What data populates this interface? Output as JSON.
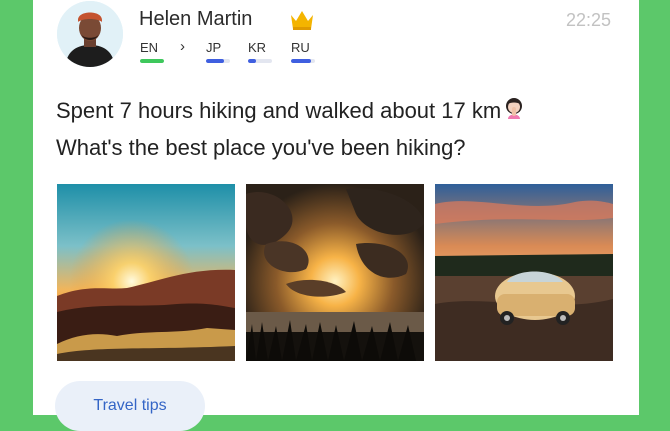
{
  "post": {
    "author": "Helen Martin",
    "time": "22:25",
    "badge_icon": "crown-icon",
    "languages": [
      {
        "code": "EN",
        "level": 1.0,
        "color": "#3ec85c"
      },
      {
        "code": "JP",
        "level": 0.75,
        "color": "#3f5fe0"
      },
      {
        "code": "KR",
        "level": 0.35,
        "color": "#3f5fe0"
      },
      {
        "code": "RU",
        "level": 0.85,
        "color": "#3f5fe0"
      }
    ],
    "text_line1": "Spent 7 hours hiking and walked about 17 km",
    "text_line2": "What's the best place you've been hiking?",
    "emoji_icon": "woman-facepalm-emoji-icon",
    "photos": [
      "sunset-mountains-photo",
      "cloudy-sunset-photo",
      "vintage-car-field-photo"
    ],
    "tag_label": "Travel tips"
  }
}
